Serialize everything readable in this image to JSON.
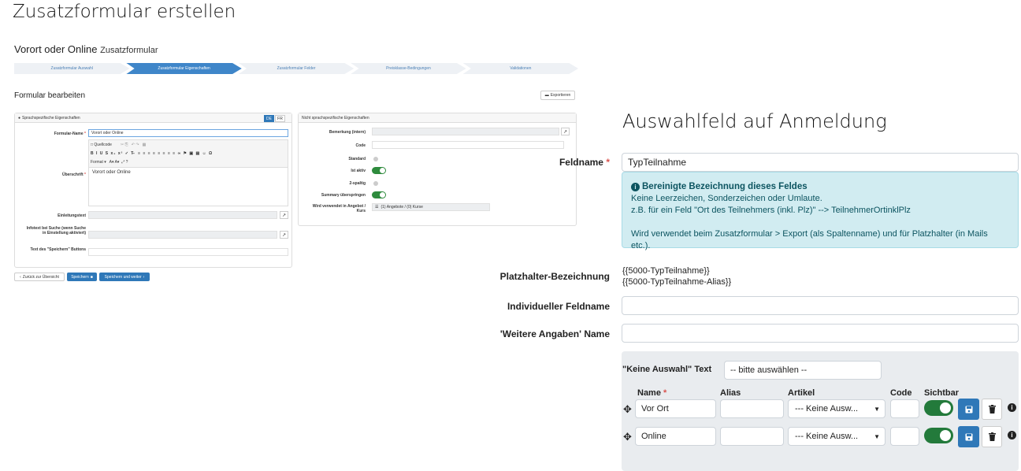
{
  "captions": {
    "left": "Zusatzformular erstellen",
    "right": "Auswahlfeld auf Anmeldung"
  },
  "shot": {
    "title": "Vorort oder Online",
    "title_sub": "Zusatzformular",
    "steps": [
      "Zusatzformular Auswahl",
      "Zusatzformular Eigenschaften",
      "Zusatzformular Felder",
      "Preisklasse-Bedingungen",
      "Validationen"
    ],
    "active_step": 1,
    "section_title": "Formular bearbeiten",
    "export_label": "Exportieren",
    "left_panel": {
      "header": "Sprachspezifische Eigenschaften",
      "lang_de": "DE",
      "lang_fr": "FR",
      "formname_label": "Formular-Name",
      "formname_value": "Vorort oder Online",
      "quellcode": "Quellcode",
      "format": "Format",
      "ueberschrift_label": "Überschrift",
      "ueberschrift_value": "Vorort oder Online",
      "einleitung_label": "Einleitungstext",
      "infotext_label": "Infotext bei Suche (wenn Suche in Einstellung aktiviert)",
      "speichern_label": "Text des \"Speichern\" Buttons"
    },
    "right_panel": {
      "header": "Nicht sprachspezifische Eigenschaften",
      "bemerkung_label": "Bemerkung (intern)",
      "code_label": "Code",
      "standard_label": "Standard",
      "aktiv_label": "Ist aktiv",
      "zweispaltig_label": "2-spaltig",
      "summary_label": "Summary überspringen",
      "verwendet_label": "Wird verwendet in Angebot / Kurs",
      "verwendet_value": "(1) Angebote / (0) Kurse"
    },
    "buttons": {
      "back": "Zurück zur Übersicht",
      "save": "Speichern",
      "save_next": "Speichern und weiter"
    }
  },
  "form": {
    "feldname_label": "Feldname",
    "feldname_value": "TypTeilnahme",
    "info_title": "Bereinigte Bezeichnung dieses Feldes",
    "info_line1": "Keine Leerzeichen, Sonderzeichen oder Umlaute.",
    "info_line2": "z.B. für ein Feld \"Ort des Teilnehmers (inkl. Plz)\" --> TeilnehmerOrtinklPlz",
    "info_line3": "Wird verwendet beim Zusatzformular > Export (als Spaltenname) und für Platzhalter (in Mails etc.).",
    "platzhalter_label": "Platzhalter-Bezeichnung",
    "platzhalter_1": "{{5000-TypTeilnahme}}",
    "platzhalter_2": "{{5000-TypTeilnahme-Alias}}",
    "individuell_label": "Individueller Feldname",
    "weitere_label": "'Weitere Angaben' Name",
    "keine_label": "\"Keine Auswahl\" Text",
    "keine_value": "-- bitte auswählen --",
    "columns": {
      "name": "Name",
      "alias": "Alias",
      "artikel": "Artikel",
      "code": "Code",
      "sichtbar": "Sichtbar"
    },
    "rows": [
      {
        "name": "Vor Ort",
        "alias": "",
        "artikel": "--- Keine Ausw...",
        "code": "",
        "visible": true
      },
      {
        "name": "Online",
        "alias": "",
        "artikel": "--- Keine Ausw...",
        "code": "",
        "visible": true
      }
    ]
  }
}
